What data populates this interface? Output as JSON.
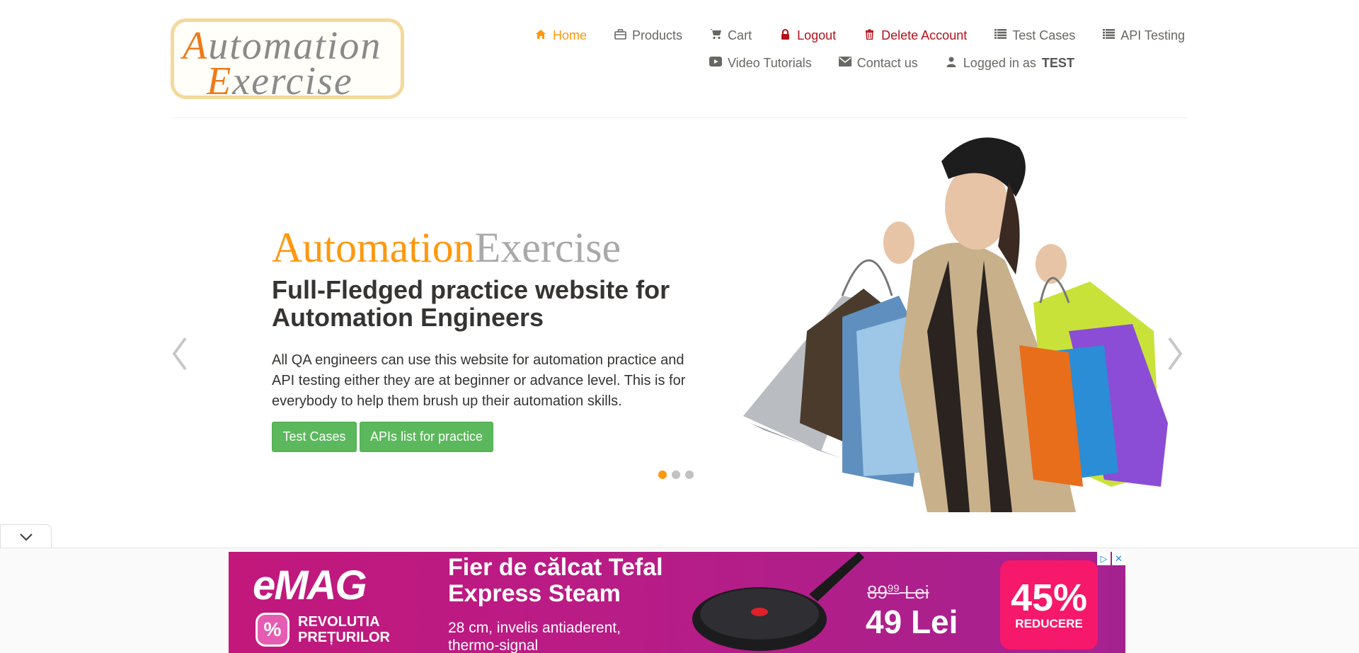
{
  "logo": {
    "line1_cap": "A",
    "line1_rest": "utomation",
    "line2_cap": "E",
    "line2_rest": "xercise"
  },
  "nav": {
    "items": [
      {
        "label": "Home",
        "icon": "home-icon"
      },
      {
        "label": "Products",
        "icon": "briefcase-icon"
      },
      {
        "label": "Cart",
        "icon": "cart-icon"
      },
      {
        "label": "Logout",
        "icon": "lock-icon"
      },
      {
        "label": "Delete Account",
        "icon": "trash-icon"
      },
      {
        "label": "Test Cases",
        "icon": "list-icon"
      },
      {
        "label": "API Testing",
        "icon": "list-icon"
      },
      {
        "label": "Video Tutorials",
        "icon": "youtube-icon"
      },
      {
        "label": "Contact us",
        "icon": "envelope-icon"
      },
      {
        "label": "Logged in as",
        "icon": "user-icon",
        "username": "TEST"
      }
    ]
  },
  "slider": {
    "brand_part1": "Automation",
    "brand_part2": "Exercise",
    "headline": "Full-Fledged practice website for Automation Engineers",
    "description": "All QA engineers can use this website for automation practice and API testing either they are at beginner or advance level. This is for everybody to help them brush up their automation skills.",
    "button_test_cases": "Test Cases",
    "button_apis": "APIs list for practice",
    "active_slide": 1,
    "slide_count": 3
  },
  "ad": {
    "brand": "eMAG",
    "brand_tagline_1": "REVOLUTIA",
    "brand_tagline_2": "PREȚURILOR",
    "title_1": "Fier de călcat Tefal",
    "title_2": "Express Steam",
    "detail_1": "28 cm, invelis antiaderent,",
    "detail_2": "thermo-signal",
    "old_price_main": "89",
    "old_price_cents": "99",
    "old_price_currency": "Lei",
    "new_price": "49 Lei",
    "discount": "45%",
    "discount_label": "REDUCERE"
  },
  "colors": {
    "accent": "#FE980F",
    "danger": "#b3131b",
    "button": "#5cb85c",
    "ad_bg": "#b81c86",
    "discount_bg": "#f6186a"
  }
}
